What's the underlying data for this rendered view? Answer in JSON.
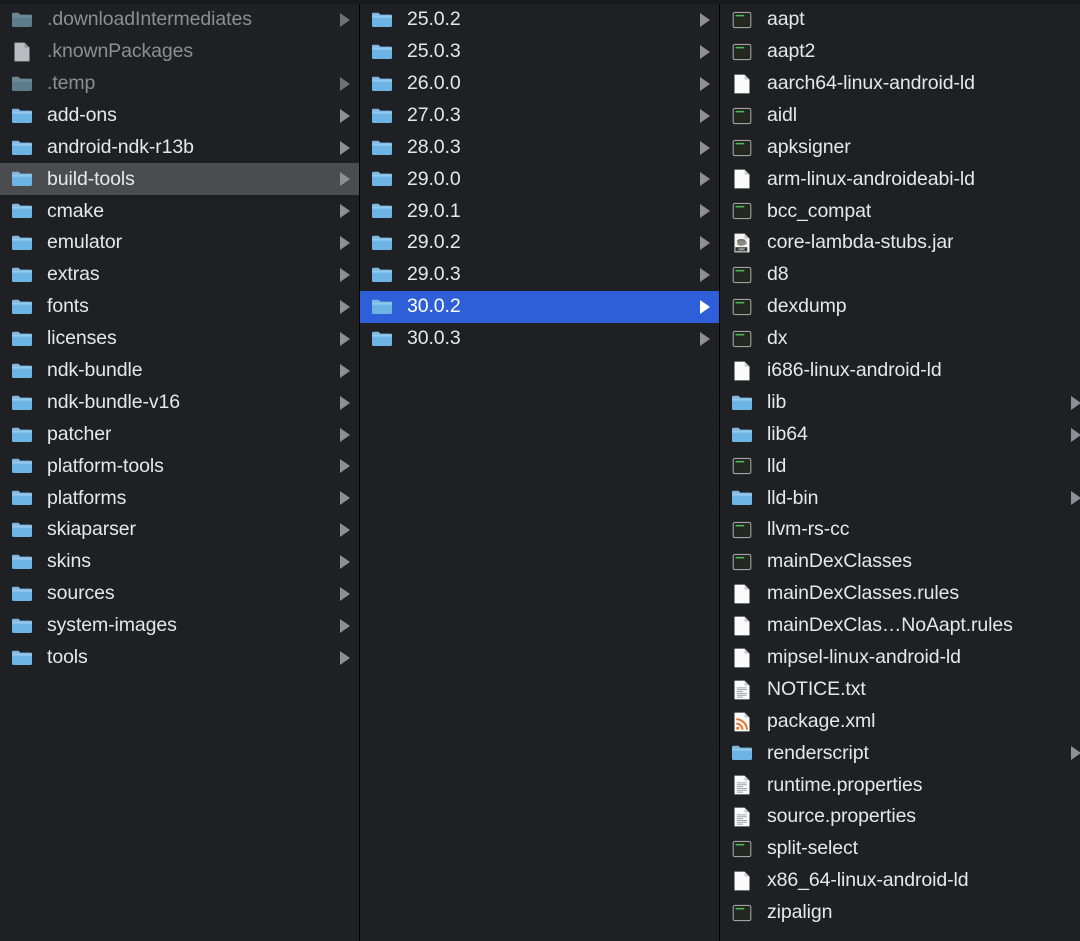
{
  "window": {
    "view": "column-view",
    "background_color": "#1e2024",
    "selection_active_color": "#2f5fd8",
    "selection_inactive_color": "#4a4c50",
    "text_color": "#e6e7e8",
    "dim_text_color": "#8b8e92"
  },
  "columns": [
    {
      "name": "sdk-root-column",
      "items": [
        {
          "label": ".downloadIntermediates",
          "icon": "folder-icon",
          "kind": "folder",
          "dim": true,
          "arrow": true,
          "selected": "none"
        },
        {
          "label": ".knownPackages",
          "icon": "document-icon",
          "kind": "file",
          "dim": true,
          "arrow": false,
          "selected": "none"
        },
        {
          "label": ".temp",
          "icon": "folder-icon",
          "kind": "folder",
          "dim": true,
          "arrow": true,
          "selected": "none"
        },
        {
          "label": "add-ons",
          "icon": "folder-icon",
          "kind": "folder",
          "dim": false,
          "arrow": true,
          "selected": "none"
        },
        {
          "label": "android-ndk-r13b",
          "icon": "folder-icon",
          "kind": "folder",
          "dim": false,
          "arrow": true,
          "selected": "none"
        },
        {
          "label": "build-tools",
          "icon": "folder-icon",
          "kind": "folder",
          "dim": false,
          "arrow": true,
          "selected": "inactive"
        },
        {
          "label": "cmake",
          "icon": "folder-icon",
          "kind": "folder",
          "dim": false,
          "arrow": true,
          "selected": "none"
        },
        {
          "label": "emulator",
          "icon": "folder-icon",
          "kind": "folder",
          "dim": false,
          "arrow": true,
          "selected": "none"
        },
        {
          "label": "extras",
          "icon": "folder-icon",
          "kind": "folder",
          "dim": false,
          "arrow": true,
          "selected": "none"
        },
        {
          "label": "fonts",
          "icon": "folder-icon",
          "kind": "folder",
          "dim": false,
          "arrow": true,
          "selected": "none"
        },
        {
          "label": "licenses",
          "icon": "folder-icon",
          "kind": "folder",
          "dim": false,
          "arrow": true,
          "selected": "none"
        },
        {
          "label": "ndk-bundle",
          "icon": "folder-icon",
          "kind": "folder",
          "dim": false,
          "arrow": true,
          "selected": "none"
        },
        {
          "label": "ndk-bundle-v16",
          "icon": "folder-icon",
          "kind": "folder",
          "dim": false,
          "arrow": true,
          "selected": "none"
        },
        {
          "label": "patcher",
          "icon": "folder-icon",
          "kind": "folder",
          "dim": false,
          "arrow": true,
          "selected": "none"
        },
        {
          "label": "platform-tools",
          "icon": "folder-icon",
          "kind": "folder",
          "dim": false,
          "arrow": true,
          "selected": "none"
        },
        {
          "label": "platforms",
          "icon": "folder-icon",
          "kind": "folder",
          "dim": false,
          "arrow": true,
          "selected": "none"
        },
        {
          "label": "skiaparser",
          "icon": "folder-icon",
          "kind": "folder",
          "dim": false,
          "arrow": true,
          "selected": "none"
        },
        {
          "label": "skins",
          "icon": "folder-icon",
          "kind": "folder",
          "dim": false,
          "arrow": true,
          "selected": "none"
        },
        {
          "label": "sources",
          "icon": "folder-icon",
          "kind": "folder",
          "dim": false,
          "arrow": true,
          "selected": "none"
        },
        {
          "label": "system-images",
          "icon": "folder-icon",
          "kind": "folder",
          "dim": false,
          "arrow": true,
          "selected": "none"
        },
        {
          "label": "tools",
          "icon": "folder-icon",
          "kind": "folder",
          "dim": false,
          "arrow": true,
          "selected": "none"
        }
      ]
    },
    {
      "name": "build-tools-versions-column",
      "items": [
        {
          "label": "25.0.2",
          "icon": "folder-icon",
          "kind": "folder",
          "dim": false,
          "arrow": true,
          "selected": "none"
        },
        {
          "label": "25.0.3",
          "icon": "folder-icon",
          "kind": "folder",
          "dim": false,
          "arrow": true,
          "selected": "none"
        },
        {
          "label": "26.0.0",
          "icon": "folder-icon",
          "kind": "folder",
          "dim": false,
          "arrow": true,
          "selected": "none"
        },
        {
          "label": "27.0.3",
          "icon": "folder-icon",
          "kind": "folder",
          "dim": false,
          "arrow": true,
          "selected": "none"
        },
        {
          "label": "28.0.3",
          "icon": "folder-icon",
          "kind": "folder",
          "dim": false,
          "arrow": true,
          "selected": "none"
        },
        {
          "label": "29.0.0",
          "icon": "folder-icon",
          "kind": "folder",
          "dim": false,
          "arrow": true,
          "selected": "none"
        },
        {
          "label": "29.0.1",
          "icon": "folder-icon",
          "kind": "folder",
          "dim": false,
          "arrow": true,
          "selected": "none"
        },
        {
          "label": "29.0.2",
          "icon": "folder-icon",
          "kind": "folder",
          "dim": false,
          "arrow": true,
          "selected": "none"
        },
        {
          "label": "29.0.3",
          "icon": "folder-icon",
          "kind": "folder",
          "dim": false,
          "arrow": true,
          "selected": "none"
        },
        {
          "label": "30.0.2",
          "icon": "folder-icon",
          "kind": "folder",
          "dim": false,
          "arrow": true,
          "selected": "active"
        },
        {
          "label": "30.0.3",
          "icon": "folder-icon",
          "kind": "folder",
          "dim": false,
          "arrow": true,
          "selected": "none"
        }
      ]
    },
    {
      "name": "build-tools-30-0-2-contents-column",
      "items": [
        {
          "label": "aapt",
          "icon": "executable-icon",
          "kind": "executable",
          "dim": false,
          "arrow": false,
          "selected": "none"
        },
        {
          "label": "aapt2",
          "icon": "executable-icon",
          "kind": "executable",
          "dim": false,
          "arrow": false,
          "selected": "none"
        },
        {
          "label": "aarch64-linux-android-ld",
          "icon": "document-icon",
          "kind": "file",
          "dim": false,
          "arrow": false,
          "selected": "none"
        },
        {
          "label": "aidl",
          "icon": "executable-icon",
          "kind": "executable",
          "dim": false,
          "arrow": false,
          "selected": "none"
        },
        {
          "label": "apksigner",
          "icon": "executable-icon",
          "kind": "executable",
          "dim": false,
          "arrow": false,
          "selected": "none"
        },
        {
          "label": "arm-linux-androideabi-ld",
          "icon": "document-icon",
          "kind": "file",
          "dim": false,
          "arrow": false,
          "selected": "none"
        },
        {
          "label": "bcc_compat",
          "icon": "executable-icon",
          "kind": "executable",
          "dim": false,
          "arrow": false,
          "selected": "none"
        },
        {
          "label": "core-lambda-stubs.jar",
          "icon": "jar-icon",
          "kind": "archive",
          "dim": false,
          "arrow": false,
          "selected": "none"
        },
        {
          "label": "d8",
          "icon": "executable-icon",
          "kind": "executable",
          "dim": false,
          "arrow": false,
          "selected": "none"
        },
        {
          "label": "dexdump",
          "icon": "executable-icon",
          "kind": "executable",
          "dim": false,
          "arrow": false,
          "selected": "none"
        },
        {
          "label": "dx",
          "icon": "executable-icon",
          "kind": "executable",
          "dim": false,
          "arrow": false,
          "selected": "none"
        },
        {
          "label": "i686-linux-android-ld",
          "icon": "document-icon",
          "kind": "file",
          "dim": false,
          "arrow": false,
          "selected": "none"
        },
        {
          "label": "lib",
          "icon": "folder-icon",
          "kind": "folder",
          "dim": false,
          "arrow": true,
          "selected": "none"
        },
        {
          "label": "lib64",
          "icon": "folder-icon",
          "kind": "folder",
          "dim": false,
          "arrow": true,
          "selected": "none"
        },
        {
          "label": "lld",
          "icon": "executable-icon",
          "kind": "executable",
          "dim": false,
          "arrow": false,
          "selected": "none"
        },
        {
          "label": "lld-bin",
          "icon": "folder-icon",
          "kind": "folder",
          "dim": false,
          "arrow": true,
          "selected": "none"
        },
        {
          "label": "llvm-rs-cc",
          "icon": "executable-icon",
          "kind": "executable",
          "dim": false,
          "arrow": false,
          "selected": "none"
        },
        {
          "label": "mainDexClasses",
          "icon": "executable-icon",
          "kind": "executable",
          "dim": false,
          "arrow": false,
          "selected": "none"
        },
        {
          "label": "mainDexClasses.rules",
          "icon": "document-icon",
          "kind": "file",
          "dim": false,
          "arrow": false,
          "selected": "none"
        },
        {
          "label": "mainDexClas…NoAapt.rules",
          "icon": "document-icon",
          "kind": "file",
          "dim": false,
          "arrow": false,
          "selected": "none"
        },
        {
          "label": "mipsel-linux-android-ld",
          "icon": "document-icon",
          "kind": "file",
          "dim": false,
          "arrow": false,
          "selected": "none"
        },
        {
          "label": "NOTICE.txt",
          "icon": "text-document-icon",
          "kind": "file",
          "dim": false,
          "arrow": false,
          "selected": "none"
        },
        {
          "label": "package.xml",
          "icon": "xml-document-icon",
          "kind": "file",
          "dim": false,
          "arrow": false,
          "selected": "none"
        },
        {
          "label": "renderscript",
          "icon": "folder-icon",
          "kind": "folder",
          "dim": false,
          "arrow": true,
          "selected": "none"
        },
        {
          "label": "runtime.properties",
          "icon": "text-document-icon",
          "kind": "file",
          "dim": false,
          "arrow": false,
          "selected": "none"
        },
        {
          "label": "source.properties",
          "icon": "text-document-icon",
          "kind": "file",
          "dim": false,
          "arrow": false,
          "selected": "none"
        },
        {
          "label": "split-select",
          "icon": "executable-icon",
          "kind": "executable",
          "dim": false,
          "arrow": false,
          "selected": "none"
        },
        {
          "label": "x86_64-linux-android-ld",
          "icon": "document-icon",
          "kind": "file",
          "dim": false,
          "arrow": false,
          "selected": "none"
        },
        {
          "label": "zipalign",
          "icon": "executable-icon",
          "kind": "executable",
          "dim": false,
          "arrow": false,
          "selected": "none"
        }
      ]
    }
  ]
}
